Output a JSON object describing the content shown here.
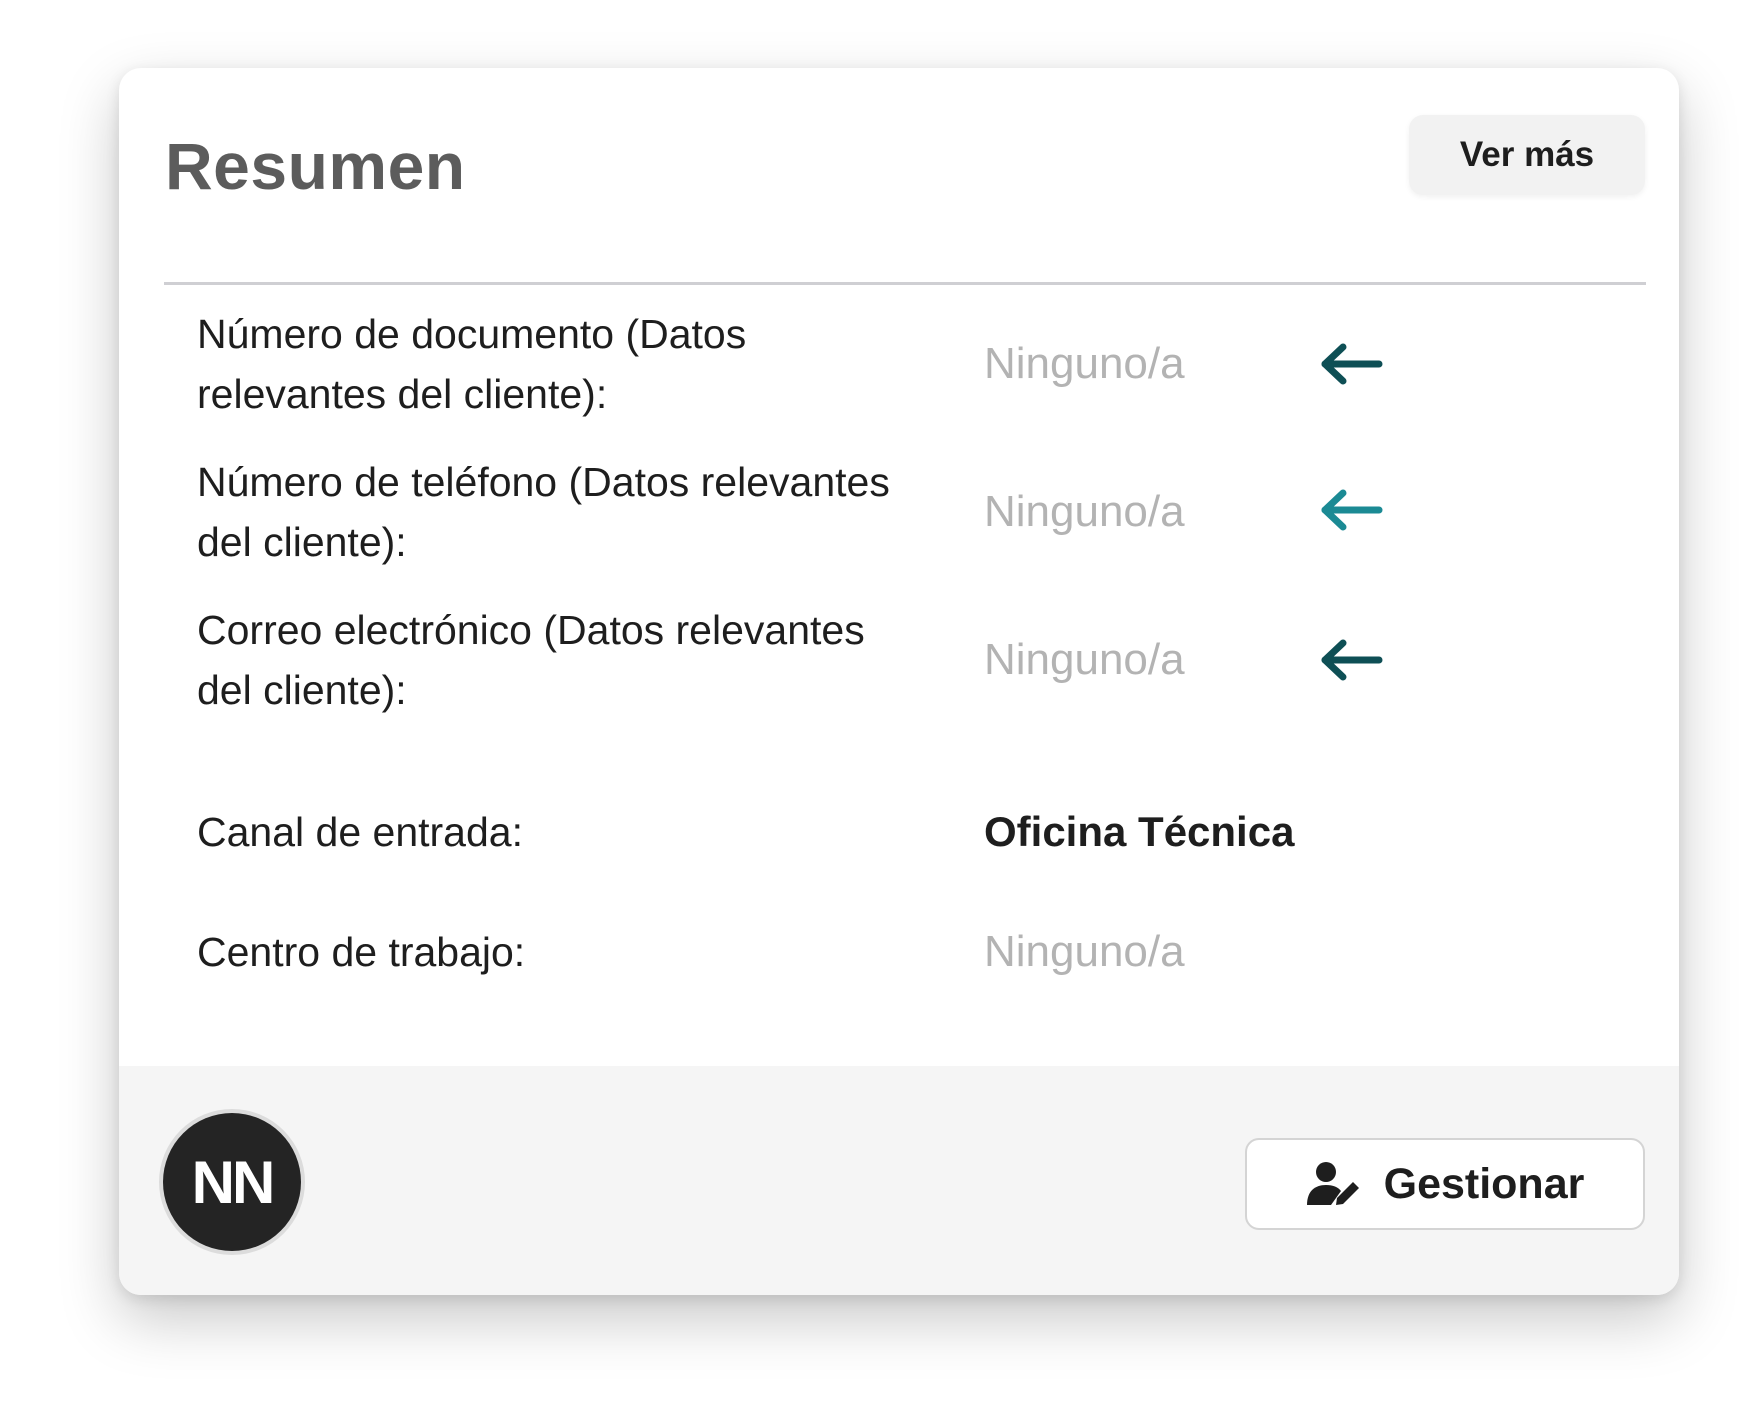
{
  "card": {
    "title": "Resumen",
    "ver_mas_label": "Ver más"
  },
  "fields": [
    {
      "label": "Número de documento (Datos relevantes del cliente):",
      "value": "Ninguno/a",
      "arrow_color": "#0e4f55"
    },
    {
      "label": "Número de teléfono (Datos relevantes del cliente):",
      "value": "Ninguno/a",
      "arrow_color": "#1b8a94"
    },
    {
      "label": "Correo electrónico (Datos relevantes del cliente):",
      "value": "Ninguno/a",
      "arrow_color": "#0e4f55"
    },
    {
      "label": "Canal de entrada:",
      "value": "Oficina Técnica"
    },
    {
      "label": "Centro de trabajo:",
      "value": "Ninguno/a"
    }
  ],
  "footer": {
    "avatar_initials": "NN",
    "gestionar_label": "Gestionar",
    "gestionar_icon": "user-edit-icon"
  },
  "colors": {
    "title": "#5c5c5c",
    "placeholder_value": "#b3b3b3",
    "text": "#1e1e1e",
    "avatar_bg": "#242424"
  }
}
